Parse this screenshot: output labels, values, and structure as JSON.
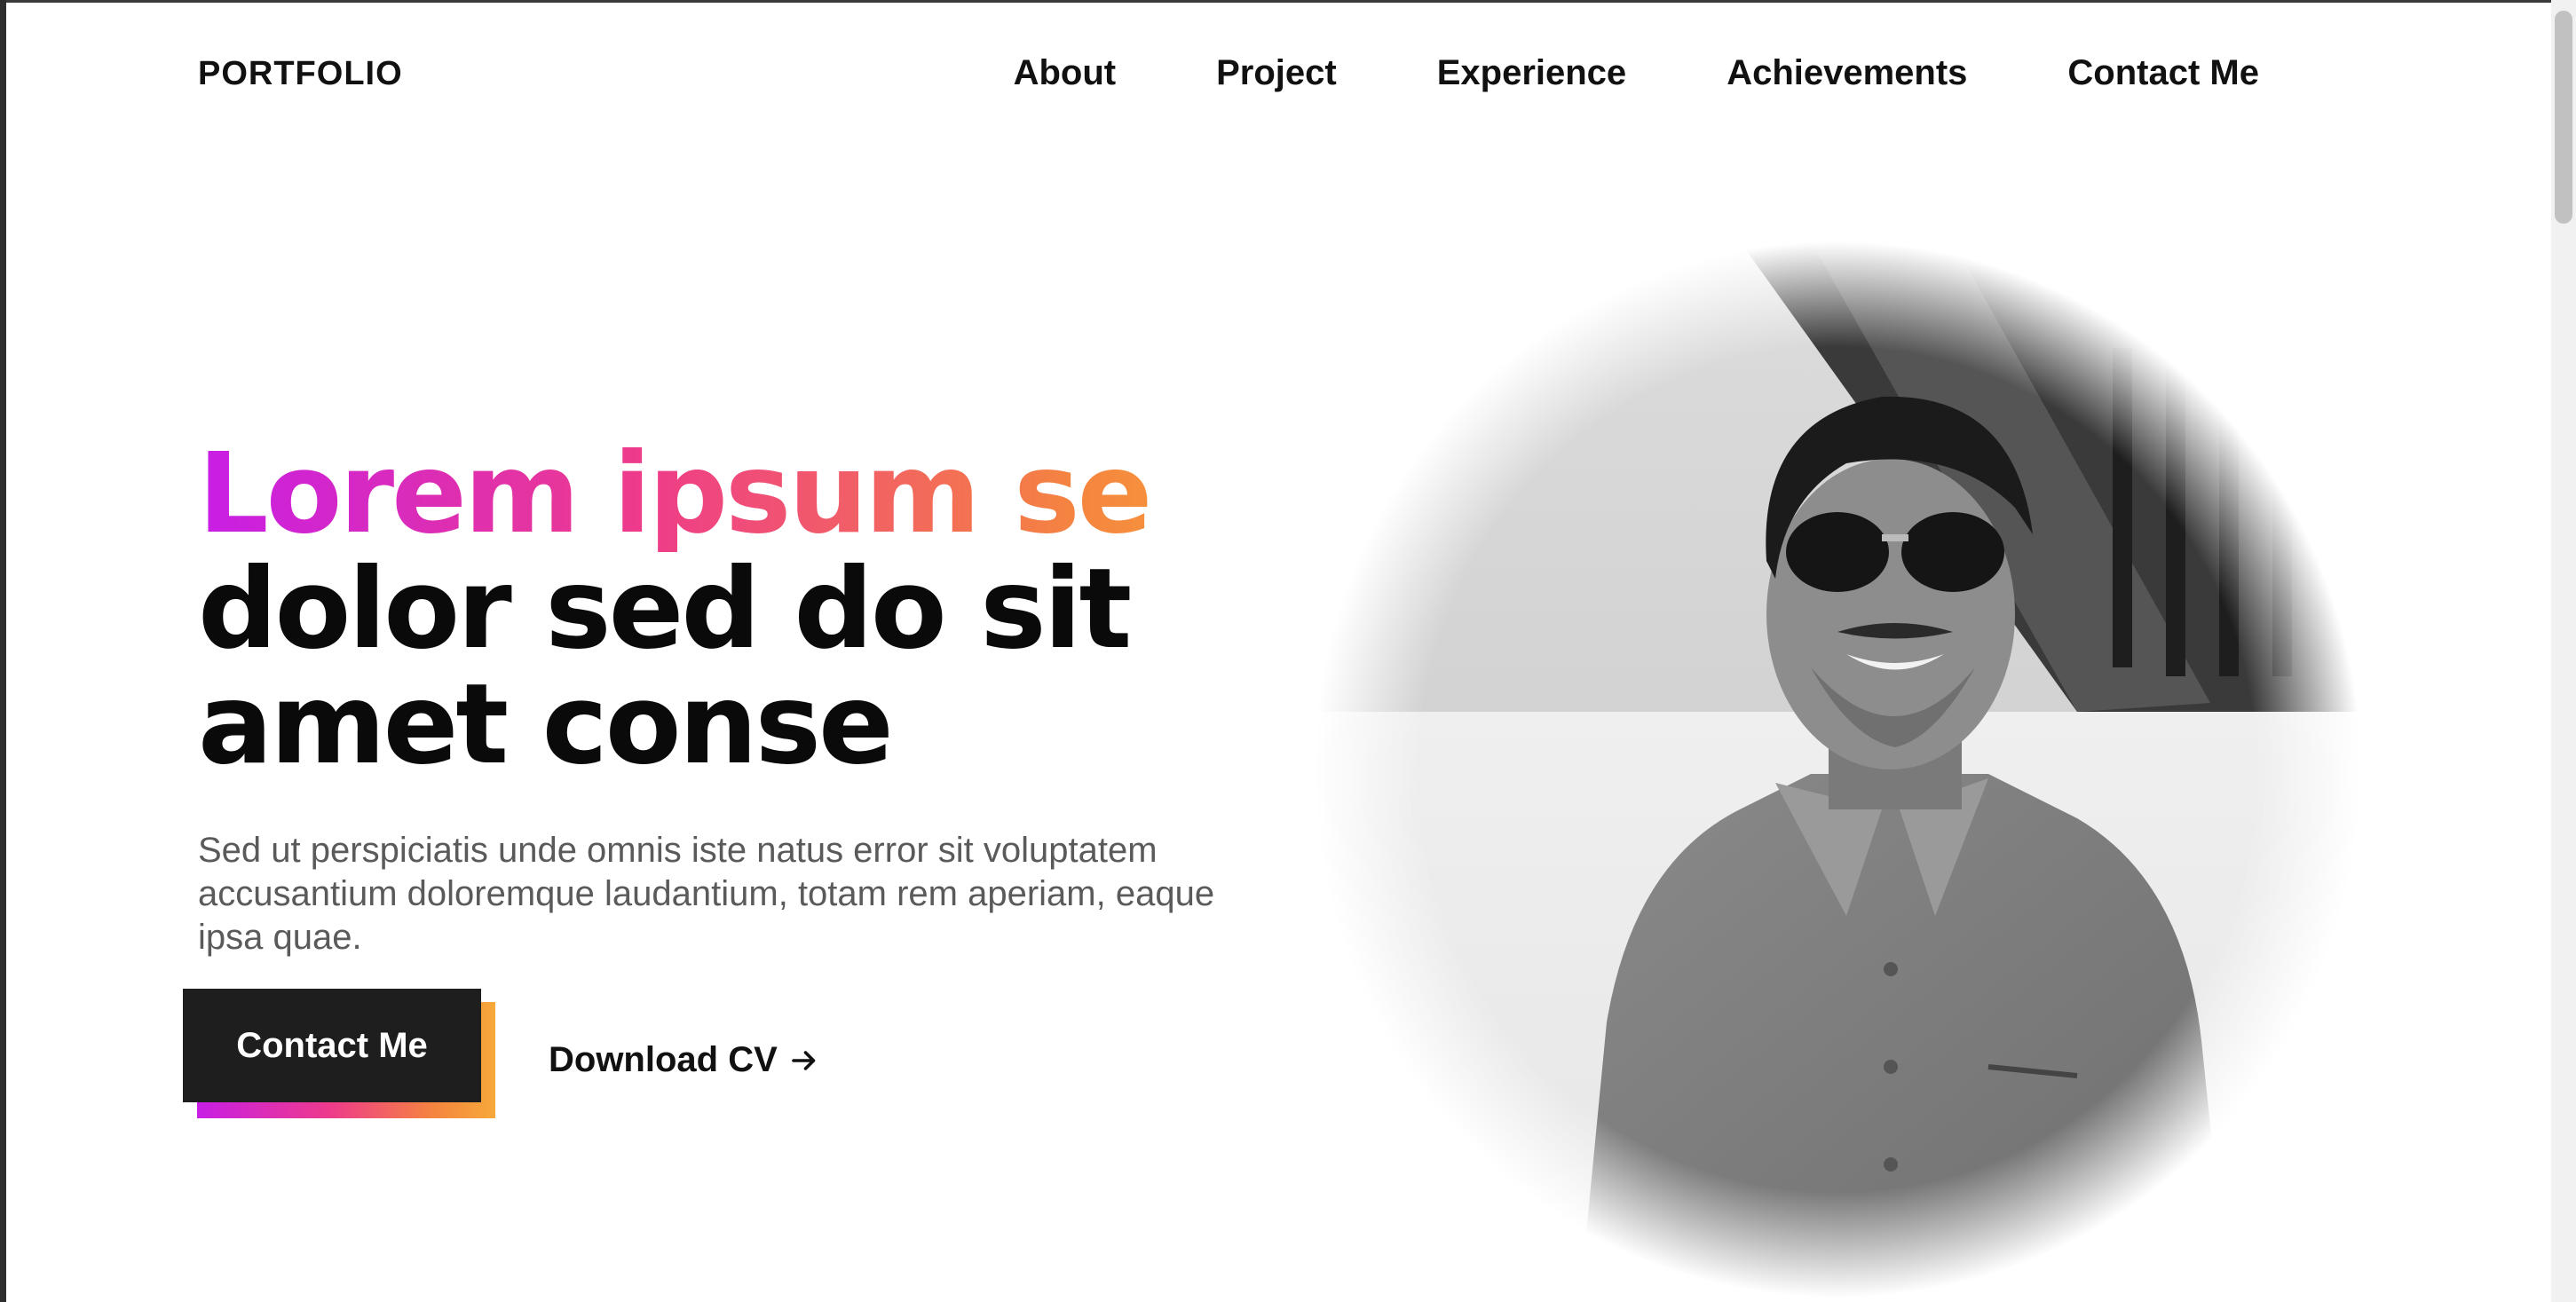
{
  "nav": {
    "brand": "PORTFOLIO",
    "items": [
      {
        "label": "About"
      },
      {
        "label": "Project"
      },
      {
        "label": "Experience"
      },
      {
        "label": "Achievements"
      },
      {
        "label": "Contact Me"
      }
    ]
  },
  "hero": {
    "title_gradient": "Lorem ipsum se",
    "title_line2": "dolor sed do sit",
    "title_line3": "amet conse",
    "description": "Sed ut perspiciatis unde omnis iste natus error sit voluptatem accusantium doloremque laudantium, totam rem aperiam, eaque ipsa quae.",
    "primary_button": "Contact Me",
    "secondary_link": "Download CV",
    "secondary_icon": "arrow-right-icon"
  },
  "portrait": {
    "icon": "portrait-photo"
  },
  "colors": {
    "gradient_start": "#c81ee6",
    "gradient_mid": "#ee3b8a",
    "gradient_end": "#f6a93a",
    "button_bg": "#1e1e1e",
    "text_primary": "#0a0a0a",
    "text_secondary": "#5a5a5a"
  }
}
